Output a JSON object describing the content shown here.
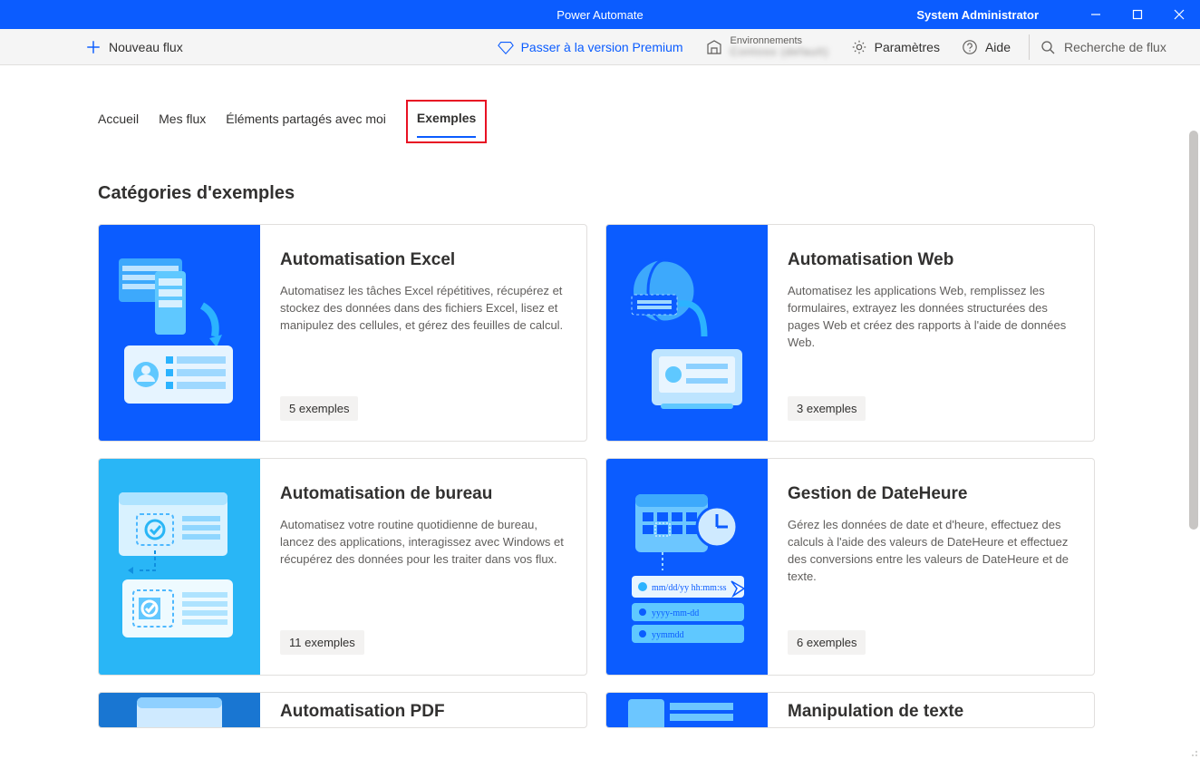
{
  "window": {
    "title": "Power Automate",
    "user": "System Administrator"
  },
  "commandBar": {
    "newFlow": "Nouveau flux",
    "premium": "Passer à la version Premium",
    "environmentsLabel": "Environnements",
    "environmentsValue": "Contoso (default)",
    "settings": "Paramètres",
    "help": "Aide",
    "searchPlaceholder": "Recherche de flux"
  },
  "tabs": {
    "home": "Accueil",
    "myFlows": "Mes flux",
    "shared": "Éléments partagés avec moi",
    "examples": "Exemples"
  },
  "sectionTitle": "Catégories d'exemples",
  "cards": [
    {
      "title": "Automatisation Excel",
      "desc": "Automatisez les tâches Excel répétitives, récupérez et stockez des données dans des fichiers Excel, lisez et manipulez des cellules, et gérez des feuilles de calcul.",
      "count": "5 exemples",
      "illus": "excel"
    },
    {
      "title": "Automatisation Web",
      "desc": "Automatisez les applications Web, remplissez les formulaires, extrayez les données structurées des pages Web et créez des rapports à l'aide de données Web.",
      "count": "3 exemples",
      "illus": "web"
    },
    {
      "title": "Automatisation de bureau",
      "desc": "Automatisez votre routine quotidienne de bureau, lancez des applications, interagissez avec Windows et récupérez des données pour les traiter dans vos flux.",
      "count": "11 exemples",
      "illus": "desktop"
    },
    {
      "title": "Gestion de DateHeure",
      "desc": "Gérez les données de date et d'heure, effectuez des calculs à l'aide des valeurs de DateHeure et effectuez des conversions entre les valeurs de DateHeure et de texte.",
      "count": "6 exemples",
      "illus": "datetime"
    },
    {
      "title": "Automatisation PDF",
      "desc": "",
      "count": "",
      "illus": "pdf"
    },
    {
      "title": "Manipulation de texte",
      "desc": "",
      "count": "",
      "illus": "text"
    }
  ]
}
